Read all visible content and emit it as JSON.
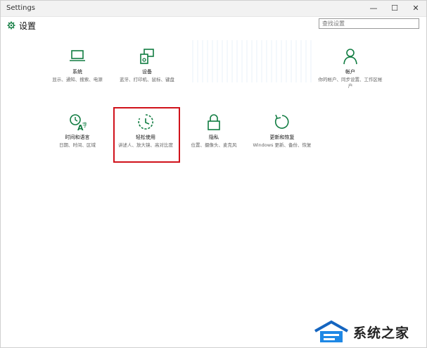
{
  "window": {
    "title": "Settings",
    "minimize": "—",
    "maximize": "☐",
    "close": "✕"
  },
  "header": {
    "title": "设置"
  },
  "search": {
    "placeholder": "查找设置"
  },
  "accent_color": "#107c41",
  "highlight_color": "#d0121b",
  "tiles": [
    {
      "name": "system",
      "icon": "laptop-icon",
      "label": "系统",
      "desc": "显示、通知、搜索、电源"
    },
    {
      "name": "devices",
      "icon": "devices-icon",
      "label": "设备",
      "desc": "蓝牙、打印机、鼠标、键盘"
    },
    {
      "name": "accounts",
      "icon": "person-icon",
      "label": "帐户",
      "desc": "你的帐户、同步设置、工作区帐户"
    },
    {
      "name": "time-language",
      "icon": "time-language-icon",
      "label": "时间和语言",
      "desc": "日期、时间、区域"
    },
    {
      "name": "ease-of-access",
      "icon": "ease-of-access-icon",
      "label": "轻松使用",
      "desc": "讲述人、放大镜、高对比度"
    },
    {
      "name": "privacy",
      "icon": "lock-icon",
      "label": "隐私",
      "desc": "位置、摄像头、麦克风"
    },
    {
      "name": "update-recovery",
      "icon": "refresh-icon",
      "label": "更新和恢复",
      "desc": "Windows 更新、备份、恢复"
    }
  ],
  "brand": {
    "text": "系统之家",
    "logo": "house-logo"
  }
}
